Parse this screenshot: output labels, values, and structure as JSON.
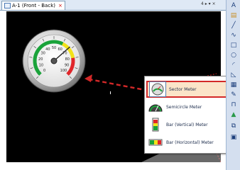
{
  "tab": {
    "title": "A-1 (Front - Back)",
    "close": "×"
  },
  "tab_controls": "4 ▸ ▾ ×",
  "gauge": {
    "ticks": [
      "0",
      "10",
      "20",
      "30",
      "40",
      "50",
      "60",
      "70",
      "80",
      "90",
      "100"
    ],
    "needle_value": 68,
    "colors": {
      "green": "#1aa33a",
      "yellow": "#f2e21a",
      "red": "#e0262a"
    }
  },
  "popup": {
    "items": [
      {
        "label": "Sector Meter",
        "selected": true,
        "icon": "sector-meter-icon"
      },
      {
        "label": "Semicircle Meter",
        "selected": false,
        "icon": "semicircle-meter-icon"
      },
      {
        "label": "Bar (Vertical) Meter",
        "selected": false,
        "icon": "bar-vertical-meter-icon"
      },
      {
        "label": "Bar (Horizontal) Meter",
        "selected": false,
        "icon": "bar-horizontal-meter-icon"
      }
    ]
  },
  "toolbar": {
    "items": [
      "text-tool-icon",
      "folder-icon",
      "line-tool-icon",
      "polyline-tool-icon",
      "rectangle-tool-icon",
      "circle-tool-icon",
      "arc-tool-icon",
      "sector-tool-icon",
      "grid-tool-icon",
      "pen-tool-icon",
      "lamp-tool-icon",
      "switch-tool-icon"
    ]
  },
  "accent_red": "#d32828"
}
